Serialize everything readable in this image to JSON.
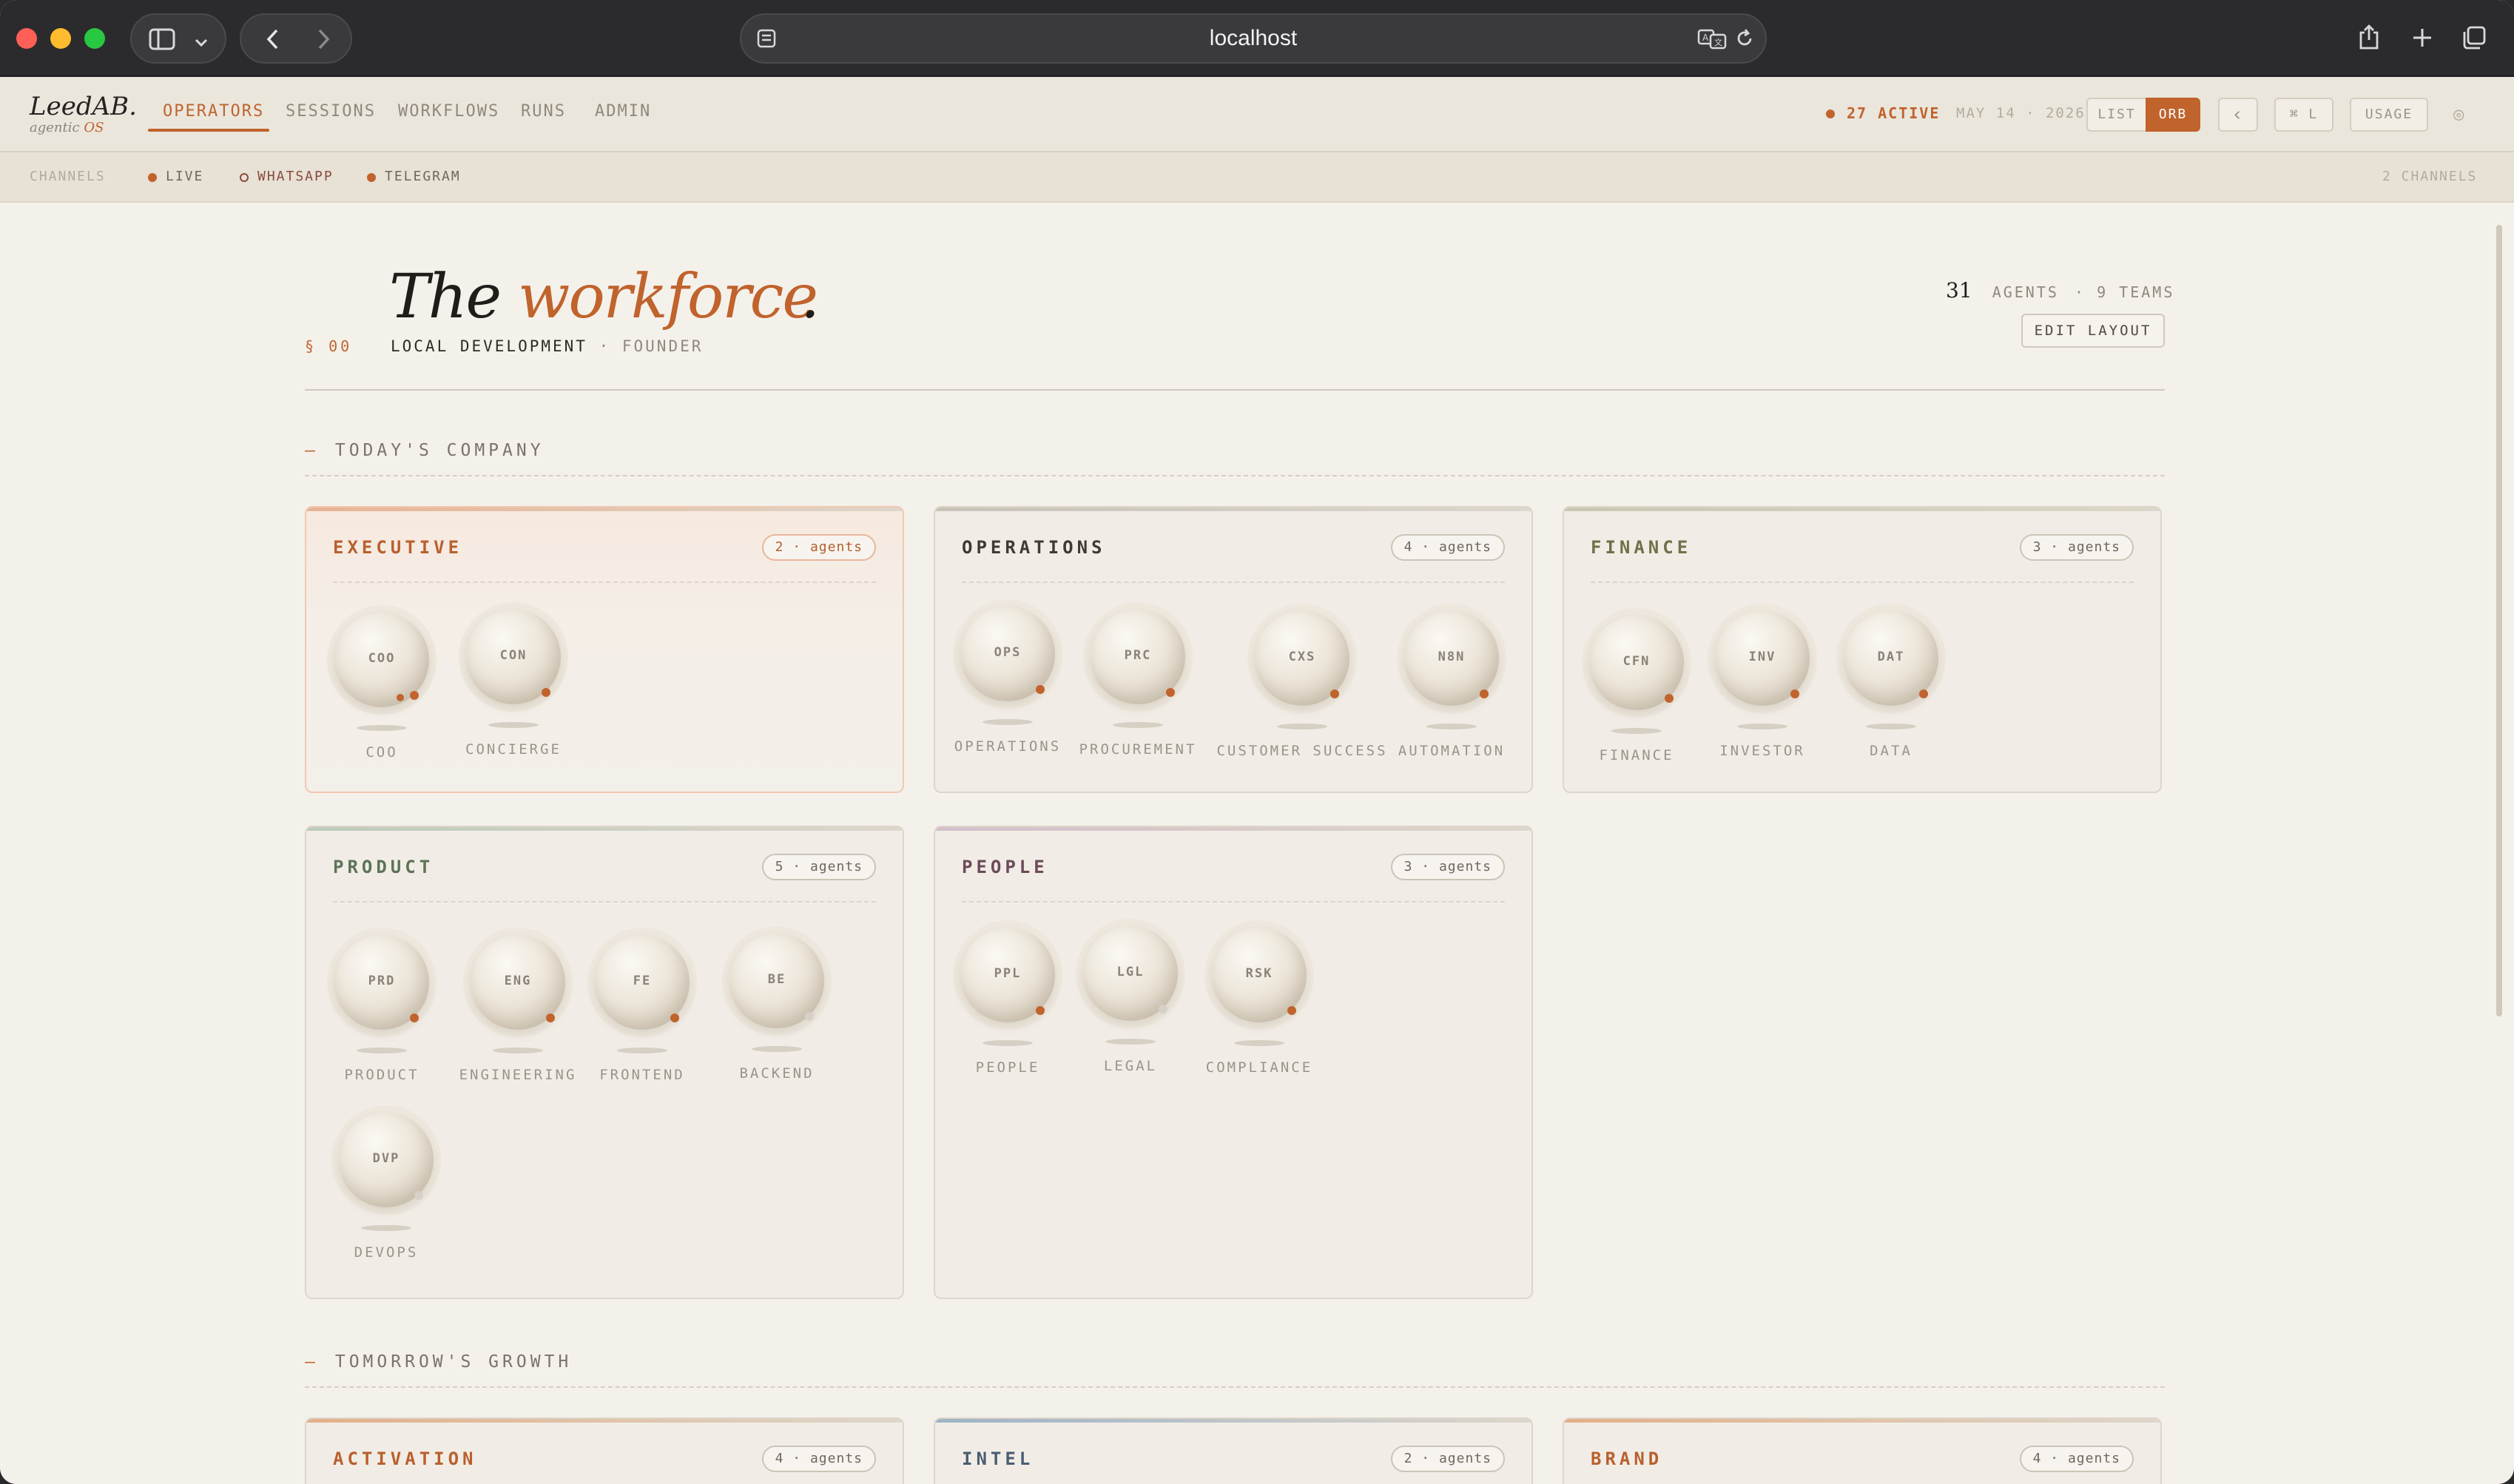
{
  "browser": {
    "url": "localhost"
  },
  "app": {
    "logo": "LeedAB.",
    "logo_sub": "agentic",
    "logo_sub_accent": "OS",
    "tabs": [
      "OPERATORS",
      "SESSIONS",
      "WORKFLOWS",
      "RUNS",
      "ADMIN"
    ],
    "active_tab": "OPERATORS",
    "active_count": "27 ACTIVE",
    "date": "MAY 14 · 2026",
    "view_list": "LIST",
    "view_orb": "ORB",
    "back_label": "‹",
    "shortcut": "⌘ L",
    "usage": "USAGE",
    "settings_glyph": "◎"
  },
  "channels": {
    "label": "CHANNELS",
    "items": [
      {
        "name": "LIVE",
        "color": "#c0632c",
        "filled": true
      },
      {
        "name": "WHATSAPP",
        "color": "#8a4a3a",
        "filled": false
      },
      {
        "name": "TELEGRAM",
        "color": "#c0632c",
        "filled": true
      }
    ],
    "count": "2 CHANNELS"
  },
  "hero": {
    "title_part1": "The",
    "title_accent": "workforce",
    "title_end": ".",
    "section_num": "§ 00",
    "subtitle": "LOCAL DEVELOPMENT",
    "subtitle_sep": " · ",
    "role": "FOUNDER",
    "agents_count": "31",
    "agents_label": "AGENTS",
    "teams_label": "· 9 TEAMS",
    "edit_layout": "EDIT LAYOUT"
  },
  "sections": {
    "today": "TODAY'S COMPANY",
    "tomorrow": "TOMORROW'S GROWTH"
  },
  "teams": [
    {
      "name": "EXECUTIVE",
      "count": "2 · agents",
      "title_color": "#b9602d",
      "line_color": "#e9b393",
      "agents": [
        {
          "code": "COO",
          "label": "COO",
          "active": true,
          "double": true
        },
        {
          "code": "CON",
          "label": "CONCIERGE",
          "active": true
        }
      ]
    },
    {
      "name": "OPERATIONS",
      "count": "4 · agents",
      "title_color": "#3f3a34",
      "line_color": "#c9c2b6",
      "agents": [
        {
          "code": "OPS",
          "label": "OPERATIONS",
          "active": true
        },
        {
          "code": "PRC",
          "label": "PROCUREMENT",
          "active": true
        },
        {
          "code": "CXS",
          "label": "CUSTOMER SUCCESS",
          "active": true
        },
        {
          "code": "N8N",
          "label": "AUTOMATION",
          "active": true
        }
      ]
    },
    {
      "name": "FINANCE",
      "count": "3 · agents",
      "title_color": "#6f7148",
      "line_color": "#c7c8b2",
      "agents": [
        {
          "code": "CFN",
          "label": "FINANCE",
          "active": true
        },
        {
          "code": "INV",
          "label": "INVESTOR",
          "active": true
        },
        {
          "code": "DAT",
          "label": "DATA",
          "active": true
        }
      ]
    },
    {
      "name": "PRODUCT",
      "count": "5 · agents",
      "title_color": "#5d7358",
      "line_color": "#bccbbb",
      "agents": [
        {
          "code": "PRD",
          "label": "PRODUCT",
          "active": true
        },
        {
          "code": "ENG",
          "label": "ENGINEERING",
          "active": true
        },
        {
          "code": "FE",
          "label": "FRONTEND",
          "active": true
        },
        {
          "code": "BE",
          "label": "BACKEND",
          "active": false
        },
        {
          "code": "DVP",
          "label": "DEVOPS",
          "active": false
        }
      ]
    },
    {
      "name": "PEOPLE",
      "count": "3 · agents",
      "title_color": "#6b4a5a",
      "line_color": "#d3bfca",
      "agents": [
        {
          "code": "PPL",
          "label": "PEOPLE",
          "active": true
        },
        {
          "code": "LGL",
          "label": "LEGAL",
          "active": false
        },
        {
          "code": "RSK",
          "label": "COMPLIANCE",
          "active": true
        }
      ]
    },
    {
      "name": "ACTIVATION",
      "count": "4 · agents",
      "title_color": "#b9602d",
      "line_color": "#e3b089",
      "agents": []
    },
    {
      "name": "INTEL",
      "count": "2 · agents",
      "title_color": "#4a5e72",
      "line_color": "#9fb3c7",
      "agents": []
    },
    {
      "name": "BRAND",
      "count": "4 · agents",
      "title_color": "#b9602d",
      "line_color": "#e3b089",
      "agents": []
    }
  ]
}
